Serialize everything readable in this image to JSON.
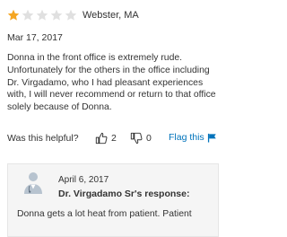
{
  "review": {
    "rating": 1,
    "max_rating": 5,
    "location": "Webster, MA",
    "date": "Mar 17, 2017",
    "text": "Donna in the front office is extremely rude. Unfortunately for the others in the office including Dr. Virgadamo, who I had pleasant experiences with, I will never recommend or return to that office solely because of Donna.",
    "colors": {
      "star_filled": "#f5a623",
      "star_empty": "#e0e0e0",
      "link": "#0073bb"
    }
  },
  "feedback": {
    "helpful_label": "Was this helpful?",
    "thumbs_up_icon": "thumbs-up-icon",
    "thumbs_up_count": "2",
    "thumbs_down_icon": "thumbs-down-icon",
    "thumbs_down_count": "0",
    "flag_label": "Flag this",
    "flag_icon": "flag-icon"
  },
  "response": {
    "avatar_icon": "doctor-avatar-icon",
    "date": "April 6, 2017",
    "author": "Dr. Virgadamo Sr's response:",
    "text": "Donna gets a lot heat from patient. Patient"
  }
}
